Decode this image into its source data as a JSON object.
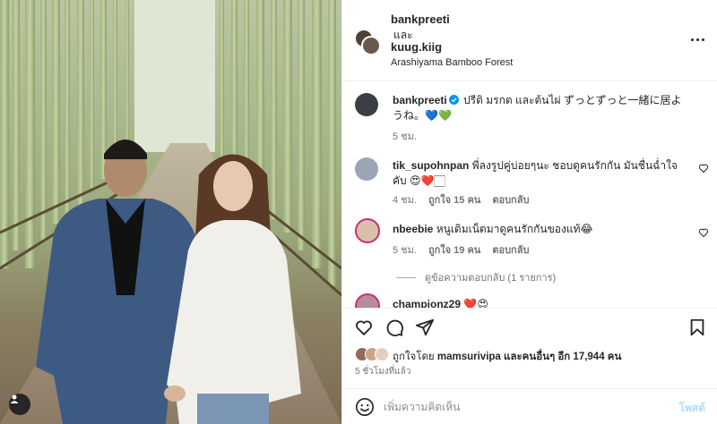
{
  "post": {
    "author": "bankpreeti",
    "and_label": "และ",
    "coauthor": "kuug.kiig",
    "location": "Arashiyama Bamboo Forest"
  },
  "caption": {
    "username": "bankpreeti",
    "text": "ปรีติ มรกต และต้นไผ่ ずっとずっと一緒に居ようね。💙💚",
    "time": "5 ชม."
  },
  "comments": [
    {
      "username": "tik_supohnpan",
      "text": "พี่ลงรูปคู่บ่อยๆนะ ชอบดูคนรักกัน มันชื่นฉ่ำใจคับ 😍❤️🏻",
      "time": "4 ชม.",
      "likes": "ถูกใจ 15 คน",
      "reply": "ตอบกลับ"
    },
    {
      "username": "nbeebie",
      "text": "หนูเดิมเน็ตมาดูคนรักกันของแท้😂",
      "time": "5 ชม.",
      "likes": "ถูกใจ 19 คน",
      "reply": "ตอบกลับ"
    },
    {
      "username": "championz29",
      "text": "❤️😍"
    }
  ],
  "view_replies": "ดูข้อความตอบกลับ (1 รายการ)",
  "likes_summary": {
    "prefix": "ถูกใจโดย",
    "user": "mamsurivipa",
    "and_others": "และคนอื่นๆ อีก 17,944 คน"
  },
  "post_time": "5 ชั่วโมงที่แล้ว",
  "comment_box": {
    "placeholder": "เพิ่มความคิดเห็น",
    "post_label": "โพสต์"
  },
  "icons": {
    "like": "heart-icon",
    "comment": "comment-icon",
    "share": "send-icon",
    "save": "bookmark-icon",
    "emoji": "emoji-icon",
    "more": "more-options-icon",
    "tags": "user-tag-icon",
    "verified": "verified-badge-icon"
  },
  "colors": {
    "link_blue": "#0095f6",
    "post_disabled": "#b3dbff",
    "text_primary": "#262626",
    "text_secondary": "#737373"
  }
}
